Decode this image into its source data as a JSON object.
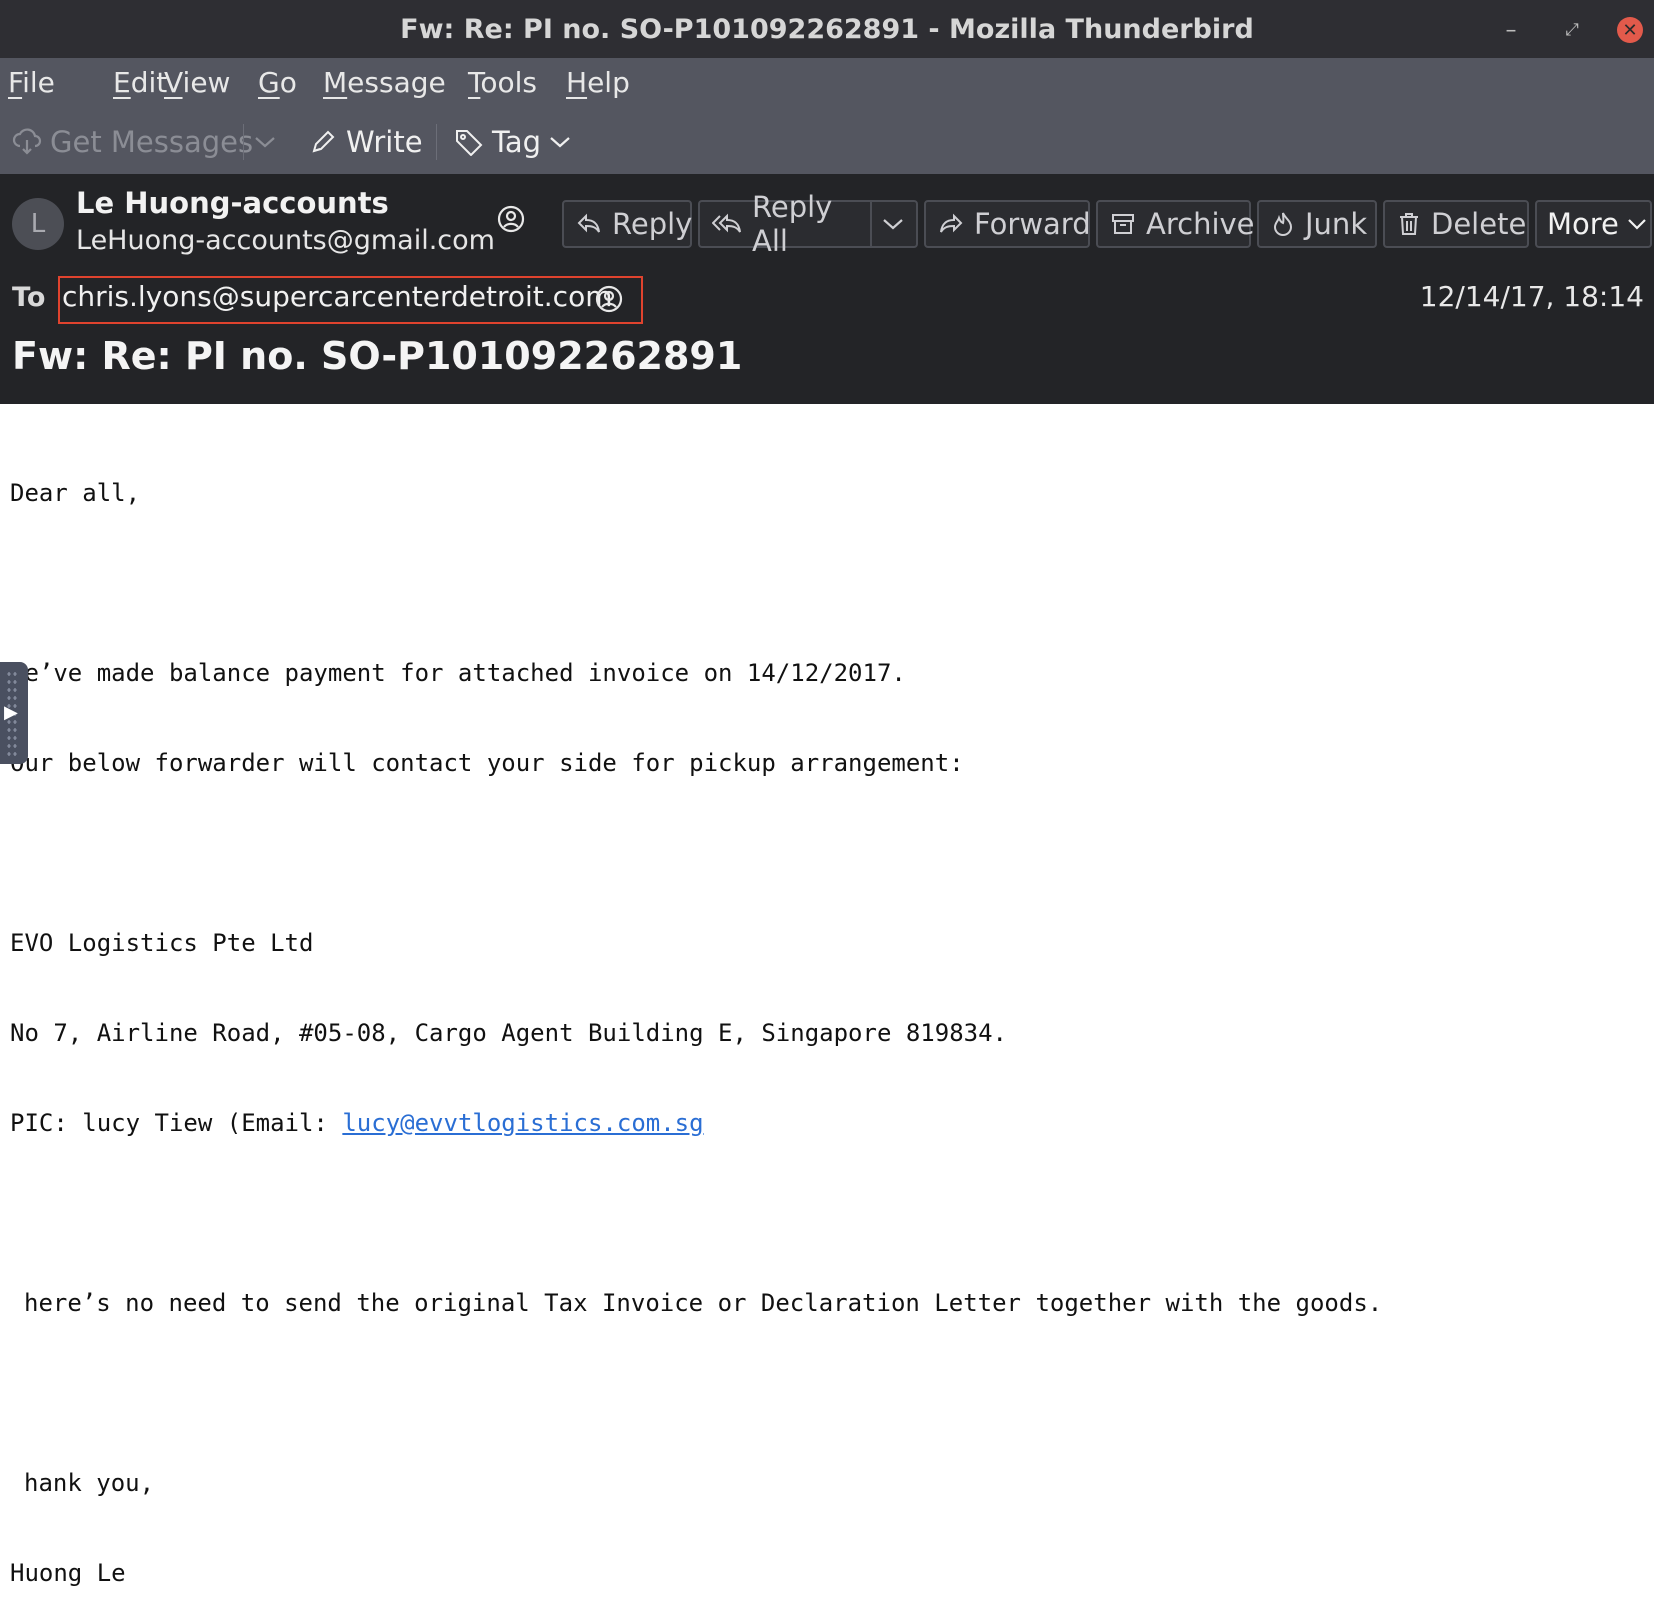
{
  "window": {
    "title": "Fw: Re: PI no. SO-P101092262891 - Mozilla Thunderbird",
    "controls": {
      "minimize": "–",
      "maximize": "⤢",
      "close": "✕"
    }
  },
  "menubar": {
    "items": [
      {
        "accel": "F",
        "rest": "ile"
      },
      {
        "accel": "E",
        "rest": "dit"
      },
      {
        "accel": "V",
        "rest": "iew"
      },
      {
        "accel": "G",
        "rest": "o"
      },
      {
        "accel": "M",
        "rest": "essage"
      },
      {
        "accel": "T",
        "rest": "ools"
      },
      {
        "accel": "H",
        "rest": "elp"
      }
    ]
  },
  "toolbar": {
    "get_messages": "Get Messages",
    "write": "Write",
    "tag": "Tag"
  },
  "header": {
    "avatar_letter": "L",
    "from_name": "Le Huong-accounts",
    "from_email": "LeHuong-accounts@gmail.com",
    "buttons": {
      "reply": "Reply",
      "reply_all": "Reply All",
      "forward": "Forward",
      "archive": "Archive",
      "junk": "Junk",
      "delete": "Delete",
      "more": "More"
    },
    "to_label": "To",
    "to_email": "chris.lyons@supercarcenterdetroit.com",
    "date": "12/14/17, 18:14",
    "subject": "Fw: Re: PI no. SO-P101092262891"
  },
  "body": {
    "greeting": "Dear all,",
    "para1_line1": "We’ve made balance payment for attached invoice on 14/12/2017.",
    "para1_line2": "Our below forwarder will contact your side for pickup arrangement:",
    "company": "EVO Logistics Pte Ltd",
    "address": "No 7, Airline Road, #05-08, Cargo Agent Building E, Singapore 819834.",
    "pic_prefix": "PIC: lucy Tiew (Email: ",
    "pic_email": "lucy@evvtlogistics.com.sg",
    "para3": "here’s no need to send the original Tax Invoice or Declaration Letter together with the goods.",
    "closing": "hank you,",
    "signature": "Huong Le"
  },
  "colors": {
    "titlebar": "#2e2e33",
    "toolbar": "#545660",
    "header": "#232427",
    "highlight_border": "#e0432e",
    "link": "#2a6ed4"
  }
}
